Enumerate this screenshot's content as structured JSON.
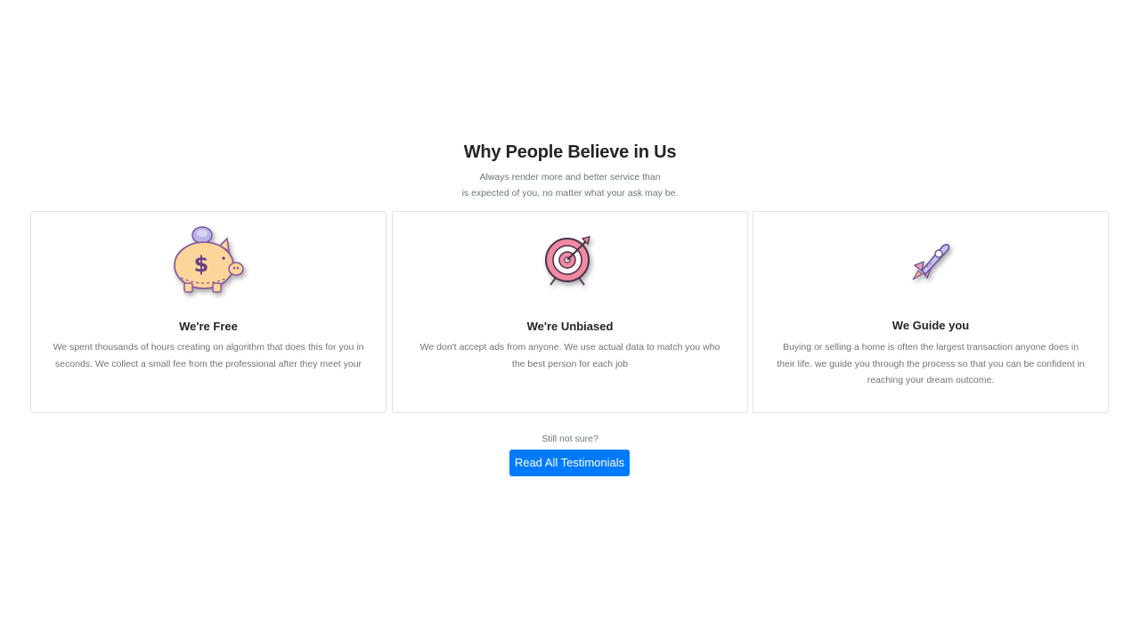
{
  "section": {
    "title": "Why People Believe in Us",
    "subtitle_line1": "Always render more and better service than",
    "subtitle_line2": "is expected of you, no matter what your ask may be."
  },
  "cards": [
    {
      "icon": "piggy-bank-icon",
      "title": "We're Free",
      "text": "We spent thousands of hours creating on algorithm that does this for you in seconds. We collect a small fee from the professional after they meet your"
    },
    {
      "icon": "target-icon",
      "title": "We're Unbiased",
      "text": "We don't accept ads from anyone. We use actual data to match you who the best person for each job"
    },
    {
      "icon": "rocket-icon",
      "title": "We Guide you",
      "text": "Buying or selling a home is often the largest transaction anyone does in their life. we guide you through the process so that you can be confident in reaching your dream outcome."
    }
  ],
  "cta": {
    "prompt": "Still not sure?",
    "button_label": "Read All Testimonials",
    "button_color": "#007bff"
  }
}
